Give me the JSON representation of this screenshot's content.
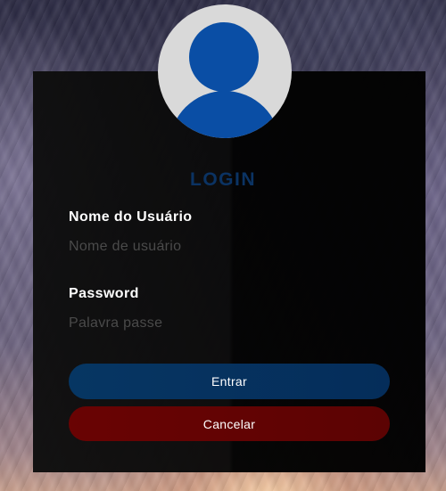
{
  "login": {
    "title": "LOGIN",
    "username_label": "Nome do Usuário",
    "username_placeholder": "Nome de usuário",
    "username_value": "",
    "password_label": "Password",
    "password_placeholder": "Palavra passe",
    "password_value": "",
    "submit_label": "Entrar",
    "cancel_label": "Cancelar"
  },
  "avatar": {
    "icon": "user-avatar-icon",
    "color": "#0a4ea5",
    "background": "#d9d9d9"
  },
  "colors": {
    "title": "#0b3363",
    "submit_button": "#063663",
    "cancel_button": "#690303",
    "panel": "#0a0a0a"
  }
}
